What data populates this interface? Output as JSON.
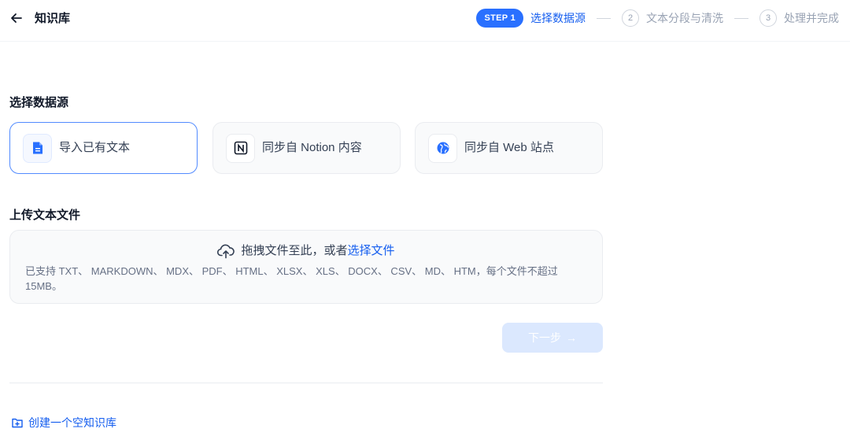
{
  "header": {
    "title": "知识库",
    "back_icon": "arrow-left-icon"
  },
  "steps": {
    "active_badge": "STEP 1",
    "active_label": "选择数据源",
    "step2_num": "2",
    "step2_label": "文本分段与清洗",
    "step3_num": "3",
    "step3_label": "处理并完成"
  },
  "data_source": {
    "title": "选择数据源",
    "options": [
      {
        "label": "导入已有文本",
        "icon": "document-icon",
        "selected": true
      },
      {
        "label": "同步自 Notion 内容",
        "icon": "notion-icon",
        "selected": false
      },
      {
        "label": "同步自 Web 站点",
        "icon": "web-globe-icon",
        "selected": false
      }
    ]
  },
  "upload": {
    "title": "上传文本文件",
    "prompt": "拖拽文件至此，或者",
    "link": "选择文件",
    "hint": "已支持 TXT、 MARKDOWN、 MDX、 PDF、 HTML、 XLSX、 XLS、 DOCX、 CSV、 MD、 HTM，每个文件不超过 15MB。"
  },
  "next_button": {
    "label": "下一步",
    "arrow": "→"
  },
  "create_empty": {
    "label": "创建一个空知识库"
  },
  "colors": {
    "accent": "#155eef",
    "badge": "#2970ff",
    "next_disabled": "#dbe8fe"
  }
}
